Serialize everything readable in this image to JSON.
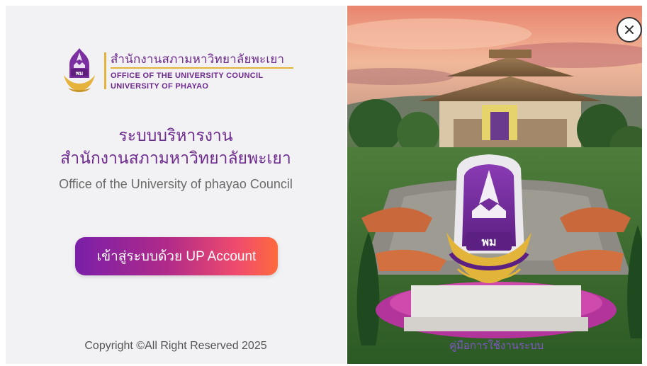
{
  "logo": {
    "thai_name": "สำนักงานสภามหาวิทยาลัยพะเยา",
    "english_line1": "OFFICE OF THE UNIVERSITY COUNCIL",
    "english_line2": "UNIVERSITY OF PHAYAO",
    "seal_icon": "university-seal-icon"
  },
  "main": {
    "title_line1": "ระบบบริหารงาน",
    "title_line2": "สำนักงานสภามหาวิทยาลัยพะเยา",
    "subtitle": "Office of the University of phayao Council",
    "login_button_label": "เข้าสู่ระบบด้วย UP Account",
    "copyright": "Copyright ©All Right Reserved 2025"
  },
  "photo": {
    "manual_link": "คู่มือการใช้งานระบบ"
  },
  "colors": {
    "brand_purple": "#6d2a8e",
    "brand_gold": "#e5b33b",
    "button_gradient_start": "#7a1fa8",
    "button_gradient_end": "#ff6a3d"
  }
}
